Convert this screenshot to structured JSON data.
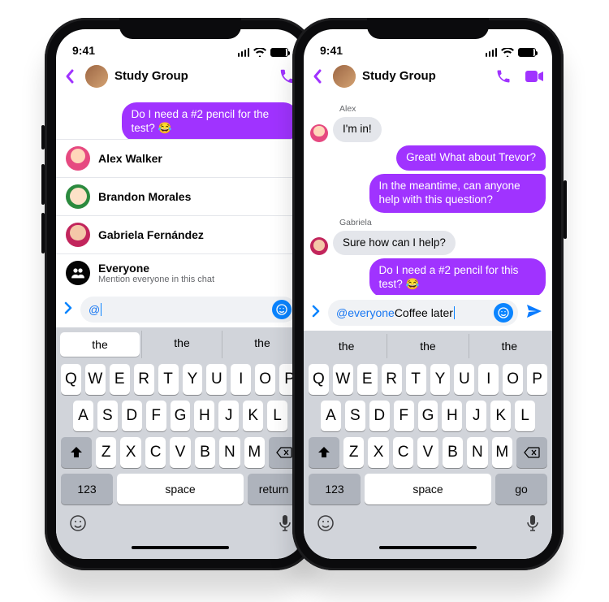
{
  "status": {
    "time": "9:41"
  },
  "header": {
    "title": "Study Group",
    "back_icon": "chevron-left"
  },
  "thread_left": {
    "outgoing": {
      "text": "Do I need a #2 pencil for the test? 😂"
    }
  },
  "mentions": {
    "items": [
      {
        "name": "Alex Walker",
        "avatar": "pink"
      },
      {
        "name": "Brandon Morales",
        "avatar": "teal"
      },
      {
        "name": "Gabriela Fernández",
        "avatar": "rose"
      }
    ],
    "everyone": {
      "name": "Everyone",
      "sub": "Mention everyone in this chat"
    }
  },
  "composer_left": {
    "prefix": "@"
  },
  "thread_right": {
    "m1_sender": "Alex",
    "m1_text": "I'm in!",
    "m2_text": "Great! What about Trevor?",
    "m3_text": "In the meantime, can anyone help with this question?",
    "m4_sender": "Gabriela",
    "m4_text": "Sure how can I help?",
    "m5_text": "Do I need a #2 pencil for this test? 😂"
  },
  "composer_right": {
    "mention": "@everyone",
    "text": " Coffee later"
  },
  "keyboard": {
    "suggestions": [
      "the",
      "the",
      "the"
    ],
    "row1": [
      "Q",
      "W",
      "E",
      "R",
      "T",
      "Y",
      "U",
      "I",
      "O",
      "P"
    ],
    "row2": [
      "A",
      "S",
      "D",
      "F",
      "G",
      "H",
      "J",
      "K",
      "L"
    ],
    "row3": [
      "Z",
      "X",
      "C",
      "V",
      "B",
      "N",
      "M"
    ],
    "num_label": "123",
    "space_label": "space",
    "return_label": "return",
    "go_label": "go"
  }
}
